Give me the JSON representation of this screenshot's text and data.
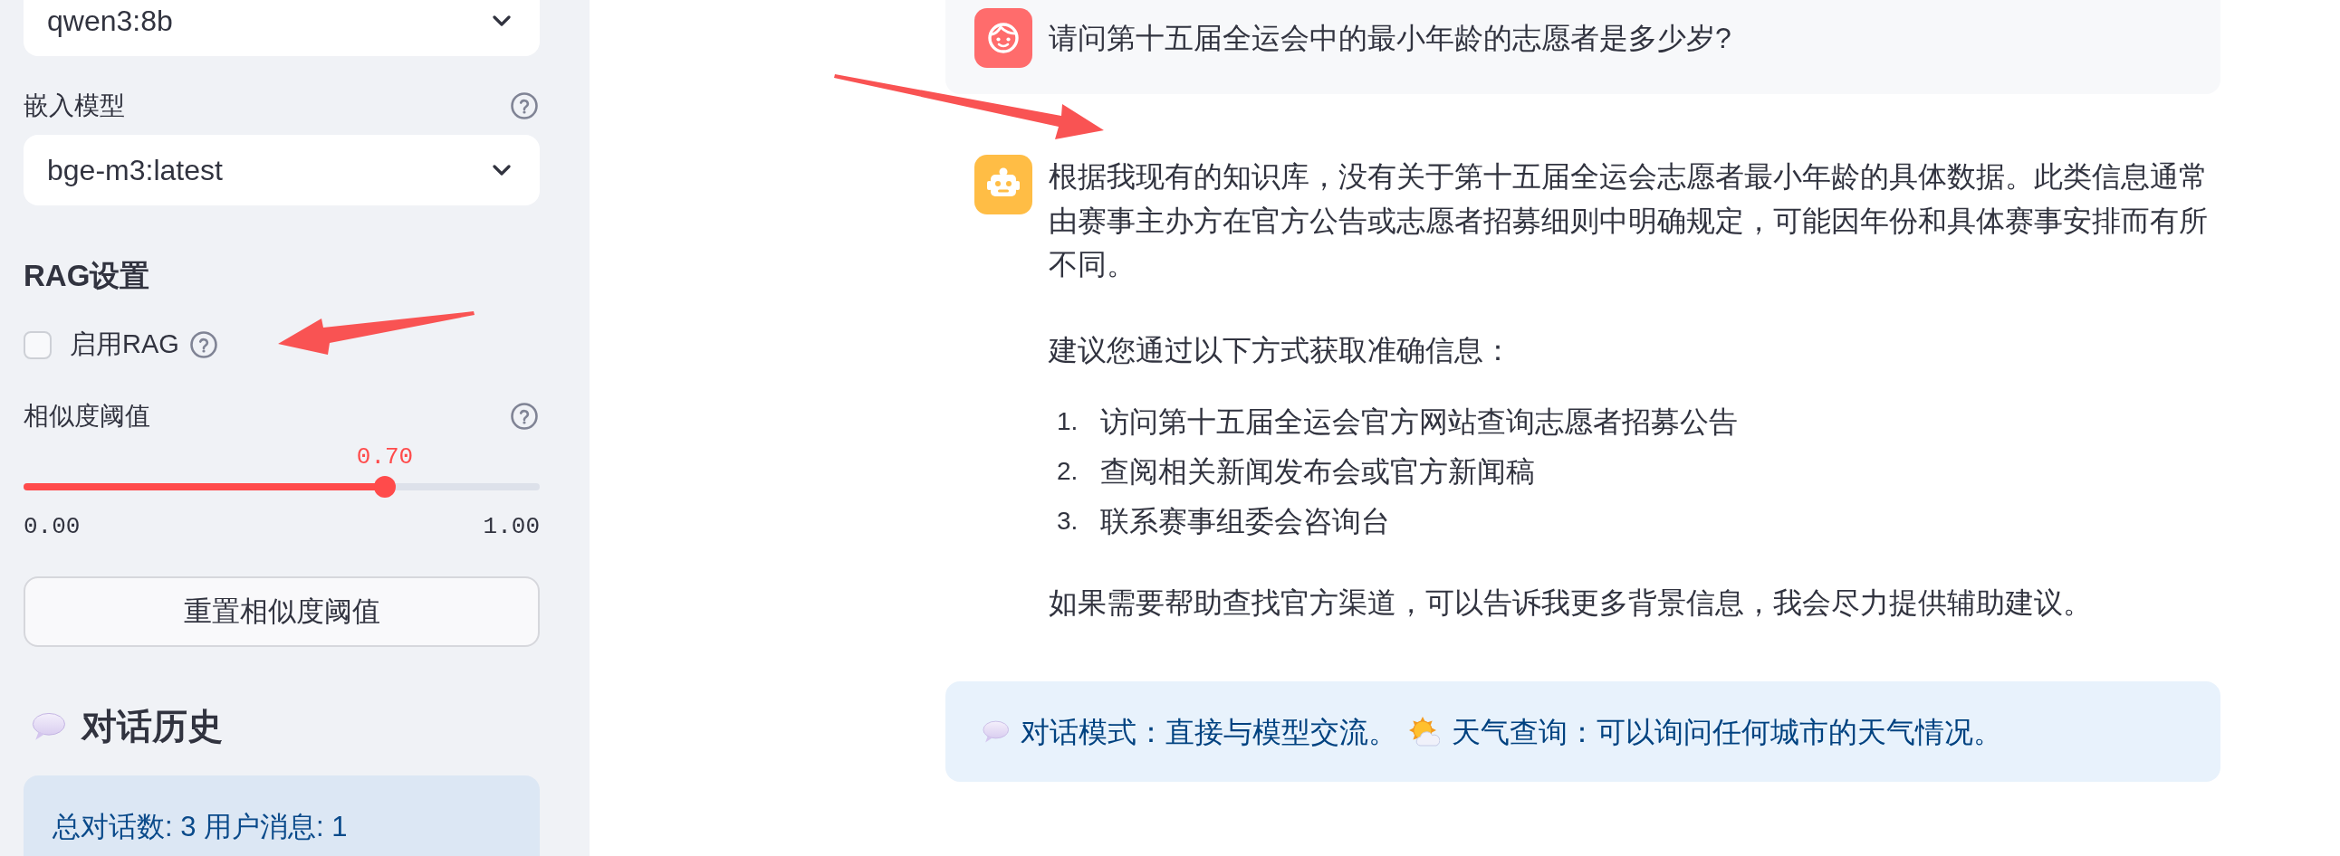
{
  "sidebar": {
    "model_select": {
      "value": "qwen3:8b"
    },
    "embedding_select": {
      "label": "嵌入模型",
      "value": "bge-m3:latest"
    },
    "rag_settings": {
      "heading": "RAG设置",
      "enable_rag": {
        "label": "启用RAG",
        "checked": false
      },
      "similarity_threshold": {
        "label": "相似度阈值",
        "value_label": "0.70",
        "level": 0.7,
        "min_label": "0.00",
        "max_label": "1.00"
      },
      "reset_button": "重置相似度阈值"
    },
    "history": {
      "heading": "对话历史",
      "summary": "总对话数: 3 用户消息: 1"
    }
  },
  "chat": {
    "messages": [
      {
        "kind": "user",
        "blocks": [
          {
            "kind": "paragraph",
            "text": "请问第十五届全运会中的最小年龄的志愿者是多少岁?"
          }
        ]
      },
      {
        "kind": "assistant",
        "blocks": [
          {
            "kind": "paragraph",
            "text": "根据我现有的知识库，没有关于第十五届全运会志愿者最小年龄的具体数据。此类信息通常由赛事主办方在官方公告或志愿者招募细则中明确规定，可能因年份和具体赛事安排而有所不同。"
          },
          {
            "kind": "paragraph",
            "text": "建议您通过以下方式获取准确信息："
          },
          {
            "kind": "list",
            "items": [
              {
                "number": "1.",
                "text": "访问第十五届全运会官方网站查询志愿者招募公告"
              },
              {
                "number": "2.",
                "text": "查阅相关新闻发布会或官方新闻稿"
              },
              {
                "number": "3.",
                "text": "联系赛事组委会咨询台"
              }
            ]
          },
          {
            "kind": "paragraph",
            "text": "如果需要帮助查找官方渠道，可以告诉我更多背景信息，我会尽力提供辅助建议。"
          }
        ]
      }
    ]
  },
  "info_banner": {
    "segments": [
      {
        "kind": "chat",
        "text": "对话模式：直接与模型交流。"
      },
      {
        "kind": "weather",
        "text": "天气查询：可以询问任何城市的天气情况。"
      }
    ]
  }
}
